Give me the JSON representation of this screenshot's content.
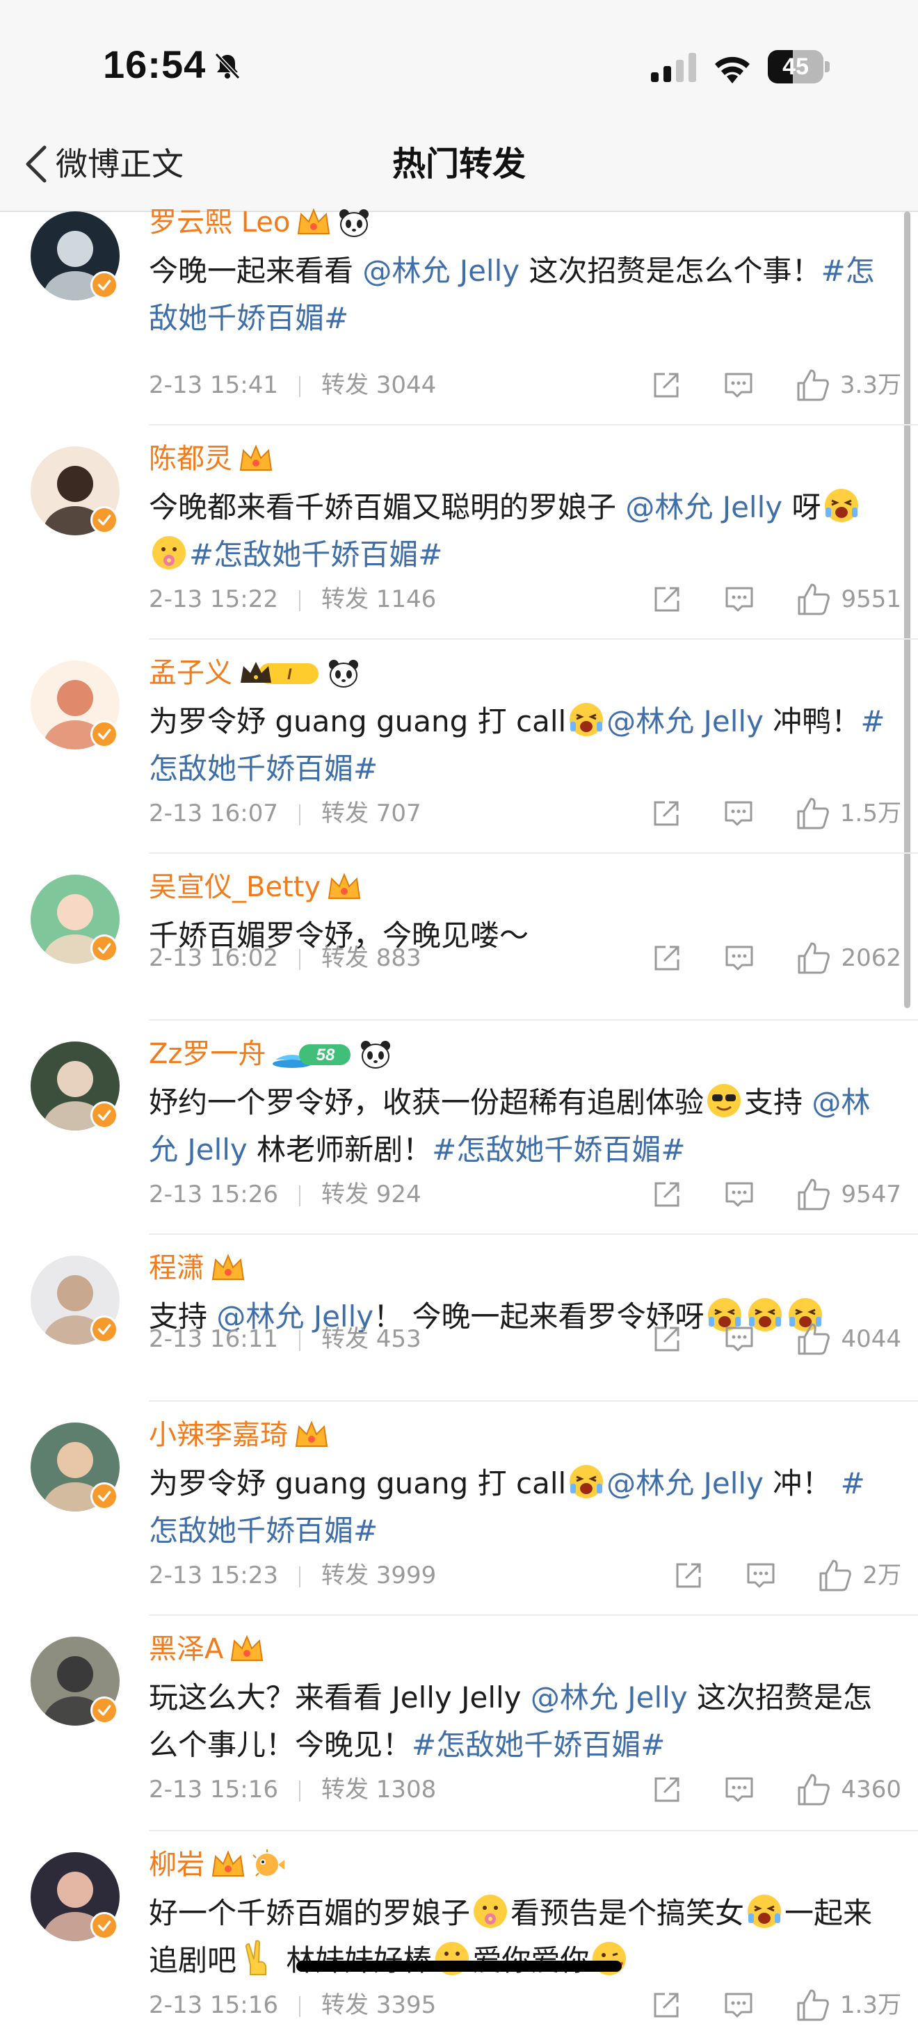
{
  "status_bar": {
    "time": "16:54",
    "battery_level": "45",
    "battery_percent": 45
  },
  "nav": {
    "back_label": "微博正文",
    "title": "热门转发"
  },
  "colors": {
    "author": "#f27b1b",
    "link": "#3f6ea8",
    "meta": "#9a9a9a",
    "verified": "#f79a2c"
  },
  "posts": [
    {
      "author": "罗云熙 Leo",
      "badges": [
        "crown-icon",
        "panda-icon"
      ],
      "content": [
        {
          "t": "text",
          "v": "今晚一起来看看 "
        },
        {
          "t": "mention",
          "v": "@林允 Jelly"
        },
        {
          "t": "text",
          "v": " 这次招赘是怎么个事！"
        },
        {
          "t": "topic",
          "v": "#怎敌她千娇百媚#"
        }
      ],
      "date": "2-13 15:41",
      "repost_label": "转发",
      "repost_count": "3044",
      "likes": "3.3万"
    },
    {
      "author": "陈都灵",
      "badges": [
        "crown-icon"
      ],
      "content": [
        {
          "t": "text",
          "v": "今晚都来看千娇百媚又聪明的罗娘子 "
        },
        {
          "t": "mention",
          "v": "@林允 Jelly"
        },
        {
          "t": "text",
          "v": " 呀"
        },
        {
          "t": "emoji",
          "v": "excited-face-emoji"
        },
        {
          "t": "emoji",
          "v": "flower-face-emoji"
        },
        {
          "t": "topic",
          "v": "#怎敌她千娇百媚#"
        }
      ],
      "date": "2-13 15:22",
      "repost_label": "转发",
      "repost_count": "1146",
      "likes": "9551"
    },
    {
      "author": "孟子义",
      "badges": [
        "crown-level-icon",
        "panda-icon"
      ],
      "content": [
        {
          "t": "text",
          "v": "为罗令妤 guang guang 打 call"
        },
        {
          "t": "emoji",
          "v": "excited-face-emoji"
        },
        {
          "t": "mention",
          "v": "@林允 Jelly"
        },
        {
          "t": "text",
          "v": " 冲鸭！"
        },
        {
          "t": "topic",
          "v": "#怎敌她千娇百媚#"
        }
      ],
      "date": "2-13 16:07",
      "repost_label": "转发",
      "repost_count": "707",
      "likes": "1.5万"
    },
    {
      "author": "吴宣仪_Betty",
      "badges": [
        "crown-icon"
      ],
      "content": [
        {
          "t": "text",
          "v": "千娇百媚罗令妤，今晚见喽～"
        }
      ],
      "date": "2-13 16:02",
      "repost_label": "转发",
      "repost_count": "883",
      "likes": "2062"
    },
    {
      "author": "Zz罗一舟",
      "badges": [
        "level-58-badge-icon",
        "panda-icon"
      ],
      "content": [
        {
          "t": "text",
          "v": "妤约一个罗令妤，收获一份超稀有追剧体验"
        },
        {
          "t": "emoji",
          "v": "sunglasses-face-emoji"
        },
        {
          "t": "text",
          "v": "支持 "
        },
        {
          "t": "mention",
          "v": "@林允 Jelly"
        },
        {
          "t": "text",
          "v": "  林老师新剧！"
        },
        {
          "t": "topic",
          "v": "#怎敌她千娇百媚#"
        }
      ],
      "date": "2-13 15:26",
      "repost_label": "转发",
      "repost_count": "924",
      "likes": "9547"
    },
    {
      "author": "程潇",
      "badges": [
        "crown-icon"
      ],
      "content": [
        {
          "t": "text",
          "v": "支持 "
        },
        {
          "t": "mention",
          "v": "@林允 Jelly"
        },
        {
          "t": "text",
          "v": "！ 今晚一起来看罗令妤呀"
        },
        {
          "t": "emoji",
          "v": "excited-face-emoji"
        },
        {
          "t": "emoji",
          "v": "excited-face-emoji"
        },
        {
          "t": "emoji",
          "v": "excited-face-emoji"
        }
      ],
      "date": "2-13 16:11",
      "repost_label": "转发",
      "repost_count": "453",
      "likes": "4044"
    },
    {
      "author": "小辣李嘉琦",
      "badges": [
        "crown-icon"
      ],
      "content": [
        {
          "t": "text",
          "v": "为罗令妤 guang guang 打 call"
        },
        {
          "t": "emoji",
          "v": "excited-face-emoji"
        },
        {
          "t": "mention",
          "v": "@林允 Jelly"
        },
        {
          "t": "text",
          "v": " 冲！ "
        },
        {
          "t": "topic",
          "v": "#怎敌她千娇百媚#"
        }
      ],
      "date": "2-13 15:23",
      "repost_label": "转发",
      "repost_count": "3999",
      "likes": "2万"
    },
    {
      "author": "黑泽A",
      "badges": [
        "crown-icon"
      ],
      "content": [
        {
          "t": "text",
          "v": "玩这么大？来看看 Jelly Jelly "
        },
        {
          "t": "mention",
          "v": "@林允 Jelly"
        },
        {
          "t": "text",
          "v": " 这次招赘是怎么个事儿！今晚见！"
        },
        {
          "t": "topic",
          "v": "#怎敌她千娇百媚#"
        }
      ],
      "date": "2-13 15:16",
      "repost_label": "转发",
      "repost_count": "1308",
      "likes": "4360"
    },
    {
      "author": "柳岩",
      "badges": [
        "crown-icon",
        "pufferfish-icon"
      ],
      "content": [
        {
          "t": "text",
          "v": "好一个千娇百媚的罗娘子"
        },
        {
          "t": "emoji",
          "v": "flower-face-emoji"
        },
        {
          "t": "text",
          "v": "看预告是个搞笑女"
        },
        {
          "t": "emoji",
          "v": "excited-face-emoji"
        },
        {
          "t": "text",
          "v": "一起来追剧吧"
        },
        {
          "t": "emoji",
          "v": "victory-hand-emoji"
        },
        {
          "t": "text",
          "v": " 林妹妹好棒"
        },
        {
          "t": "emoji",
          "v": "rainbow-face-emoji"
        },
        {
          "t": "text",
          "v": "爱你爱你"
        },
        {
          "t": "emoji",
          "v": "kiss-face-emoji"
        }
      ],
      "date": "2-13 15:16",
      "repost_label": "转发",
      "repost_count": "3395",
      "likes": "1.3万"
    }
  ]
}
